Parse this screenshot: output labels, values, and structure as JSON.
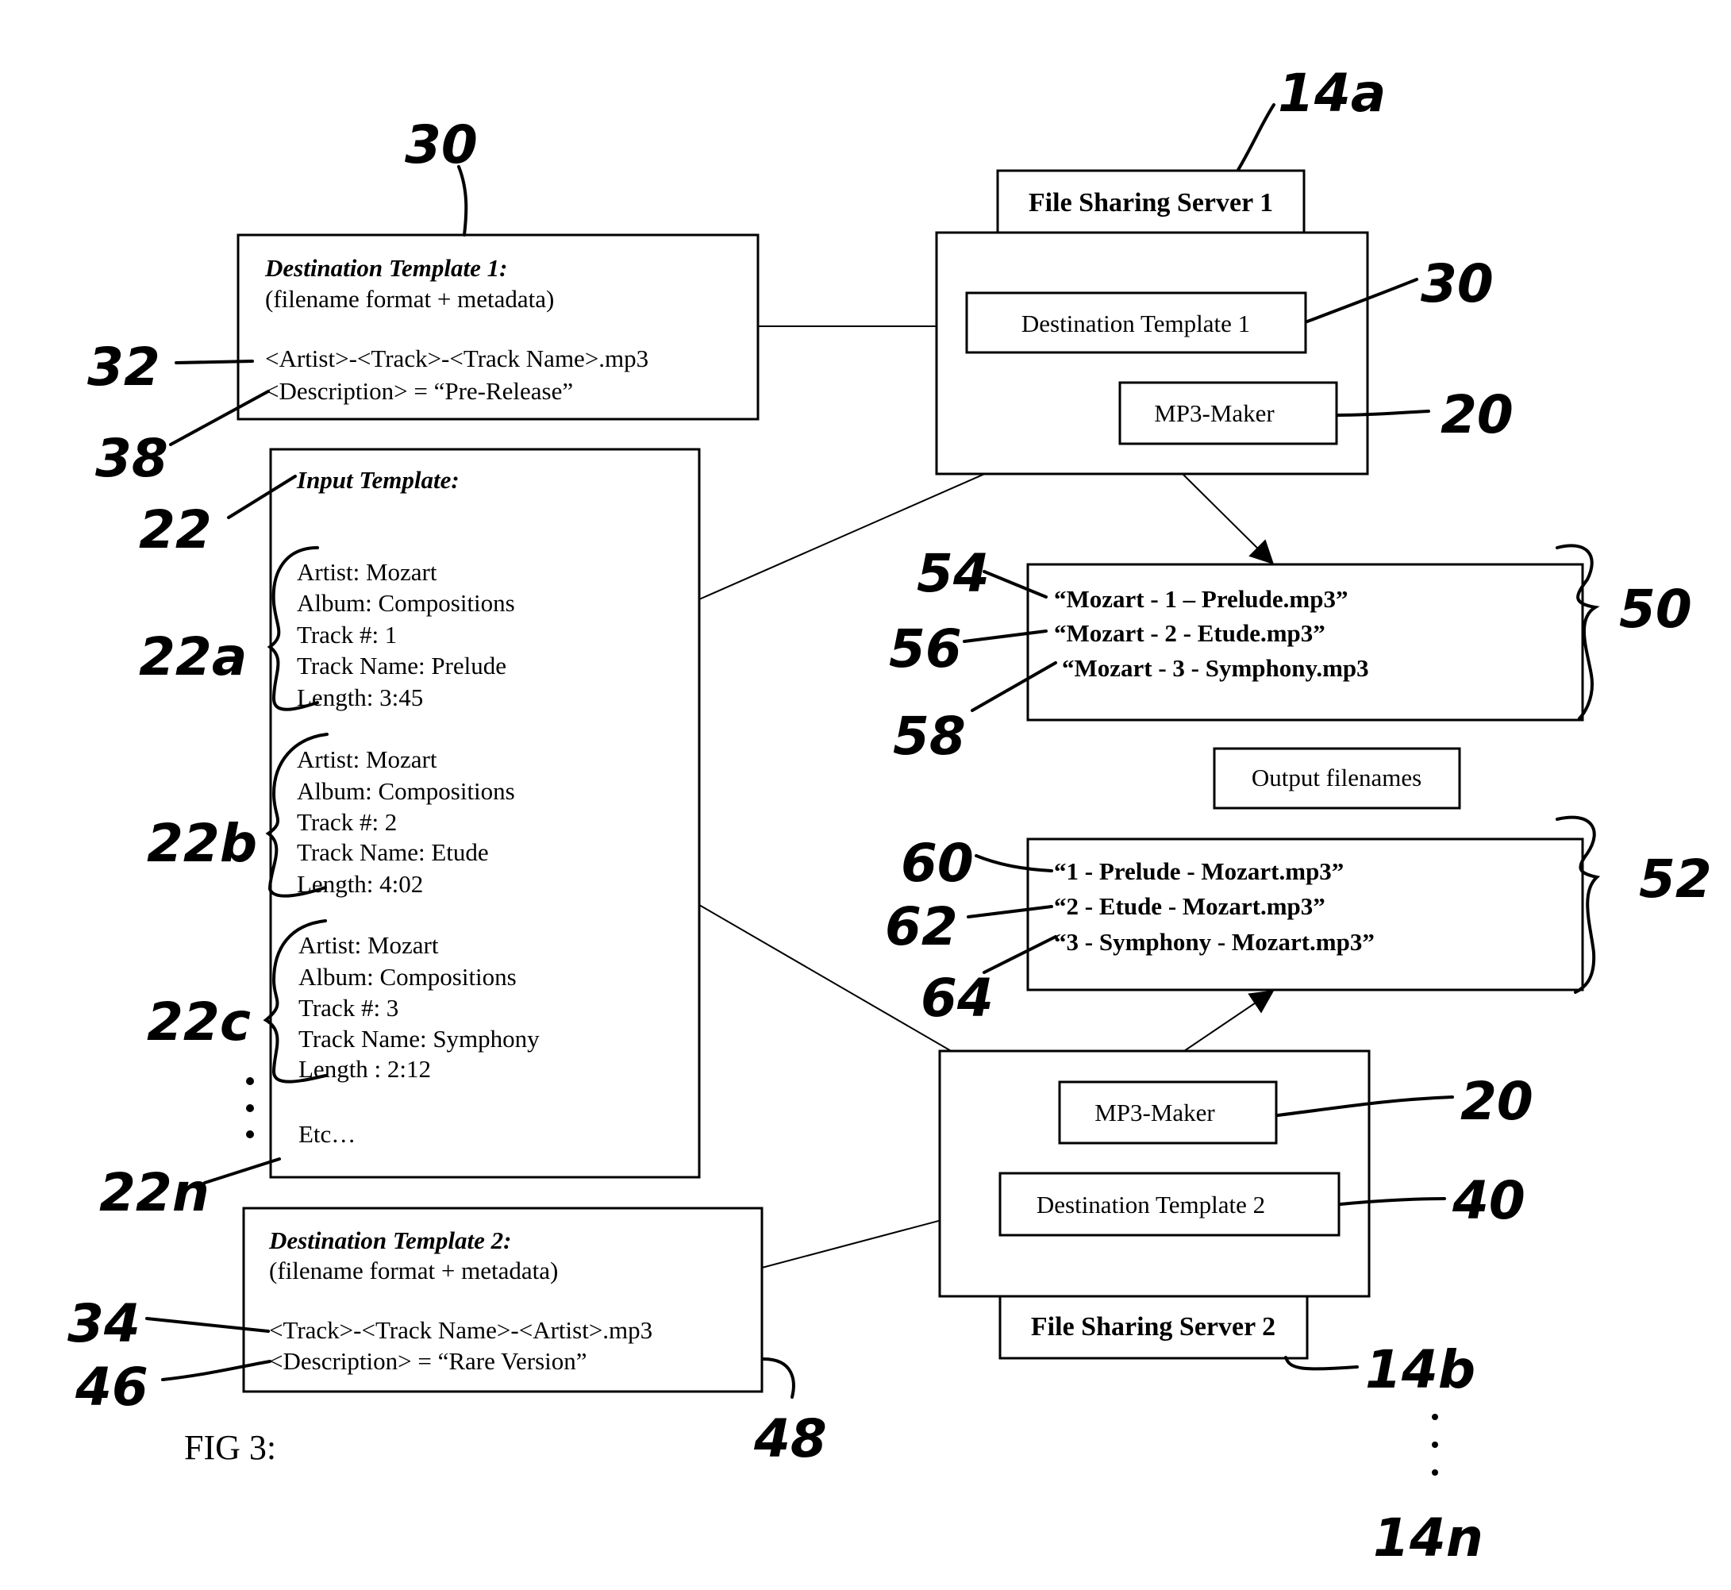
{
  "figure": {
    "caption": "FIG 3:"
  },
  "destination_template_1": {
    "ref": "30",
    "title": "Destination Template 1:",
    "subtitle": "(filename format + metadata)",
    "format_line": "<Artist>-<Track>-<Track Name>.mp3",
    "format_ref": "32",
    "description_line": "<Description> = “Pre-Release”",
    "description_ref": "38"
  },
  "input_template": {
    "ref": "22",
    "title": "Input Template:",
    "records": [
      {
        "ref": "22a",
        "lines": [
          "Artist: Mozart",
          "Album: Compositions",
          "Track #: 1",
          "Track Name: Prelude",
          "Length: 3:45"
        ]
      },
      {
        "ref": "22b",
        "lines": [
          "Artist: Mozart",
          "Album: Compositions",
          "Track #: 2",
          "Track Name: Etude",
          "Length: 4:02"
        ]
      },
      {
        "ref": "22c",
        "lines": [
          "Artist: Mozart",
          "Album: Compositions",
          "Track #: 3",
          "Track Name: Symphony",
          "Length : 2:12"
        ]
      }
    ],
    "etc": "Etc…",
    "etc_ref": "22n"
  },
  "destination_template_2": {
    "title": "Destination Template 2:",
    "subtitle": "(filename format + metadata)",
    "format_line": "<Track>-<Track Name>-<Artist>.mp3",
    "format_ref": "34",
    "description_line": "<Description> = “Rare Version”",
    "description_ref": "46",
    "box_ref": "48"
  },
  "server_1": {
    "ref": "14a",
    "label": "File Sharing Server 1",
    "template_label": "Destination Template 1",
    "template_ref": "30",
    "maker_label": "MP3-Maker",
    "maker_ref": "20"
  },
  "server_2": {
    "ref": "14b",
    "label": "File Sharing Server 2",
    "template_label": "Destination Template 2",
    "template_ref": "40",
    "maker_label": "MP3-Maker",
    "maker_ref": "20",
    "more_ref": "14n"
  },
  "output_group_1": {
    "ref": "50",
    "files": [
      {
        "ref": "54",
        "name": "“Mozart - 1 – Prelude.mp3”"
      },
      {
        "ref": "56",
        "name": "“Mozart - 2 - Etude.mp3”"
      },
      {
        "ref": "58",
        "name": "“Mozart - 3 - Symphony.mp3"
      }
    ]
  },
  "output_label": "Output filenames",
  "output_group_2": {
    "ref": "52",
    "files": [
      {
        "ref": "60",
        "name": "“1 - Prelude - Mozart.mp3”"
      },
      {
        "ref": "62",
        "name": "“2 - Etude - Mozart.mp3”"
      },
      {
        "ref": "64",
        "name": "“3 - Symphony - Mozart.mp3”"
      }
    ]
  }
}
